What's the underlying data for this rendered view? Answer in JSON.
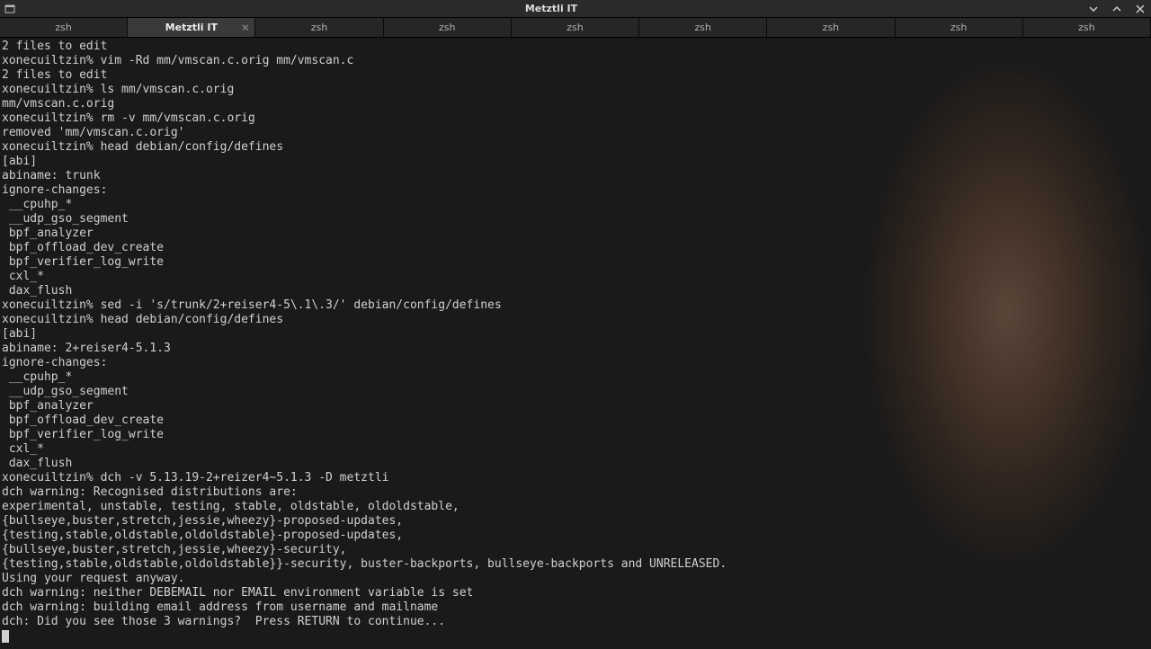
{
  "window": {
    "title": "Metztli IT"
  },
  "tabs": [
    {
      "label": "zsh",
      "active": false
    },
    {
      "label": "Metztli IT",
      "active": true
    },
    {
      "label": "zsh",
      "active": false
    },
    {
      "label": "zsh",
      "active": false
    },
    {
      "label": "zsh",
      "active": false
    },
    {
      "label": "zsh",
      "active": false
    },
    {
      "label": "zsh",
      "active": false
    },
    {
      "label": "zsh",
      "active": false
    },
    {
      "label": "zsh",
      "active": false
    }
  ],
  "terminal": {
    "lines": [
      "2 files to edit",
      "xonecuiltzin% vim -Rd mm/vmscan.c.orig mm/vmscan.c",
      "2 files to edit",
      "xonecuiltzin% ls mm/vmscan.c.orig",
      "mm/vmscan.c.orig",
      "xonecuiltzin% rm -v mm/vmscan.c.orig",
      "removed 'mm/vmscan.c.orig'",
      "xonecuiltzin% head debian/config/defines",
      "[abi]",
      "abiname: trunk",
      "ignore-changes:",
      " __cpuhp_*",
      " __udp_gso_segment",
      " bpf_analyzer",
      " bpf_offload_dev_create",
      " bpf_verifier_log_write",
      " cxl_*",
      " dax_flush",
      "xonecuiltzin% sed -i 's/trunk/2+reiser4-5\\.1\\.3/' debian/config/defines",
      "xonecuiltzin% head debian/config/defines",
      "[abi]",
      "abiname: 2+reiser4-5.1.3",
      "ignore-changes:",
      " __cpuhp_*",
      " __udp_gso_segment",
      " bpf_analyzer",
      " bpf_offload_dev_create",
      " bpf_verifier_log_write",
      " cxl_*",
      " dax_flush",
      "xonecuiltzin% dch -v 5.13.19-2+reizer4~5.1.3 -D metztli",
      "dch warning: Recognised distributions are:",
      "experimental, unstable, testing, stable, oldstable, oldoldstable,",
      "{bullseye,buster,stretch,jessie,wheezy}-proposed-updates,",
      "{testing,stable,oldstable,oldoldstable}-proposed-updates,",
      "{bullseye,buster,stretch,jessie,wheezy}-security,",
      "{testing,stable,oldstable,oldoldstable}}-security, buster-backports, bullseye-backports and UNRELEASED.",
      "Using your request anyway.",
      "dch warning: neither DEBEMAIL nor EMAIL environment variable is set",
      "dch warning: building email address from username and mailname",
      "dch: Did you see those 3 warnings?  Press RETURN to continue..."
    ]
  }
}
